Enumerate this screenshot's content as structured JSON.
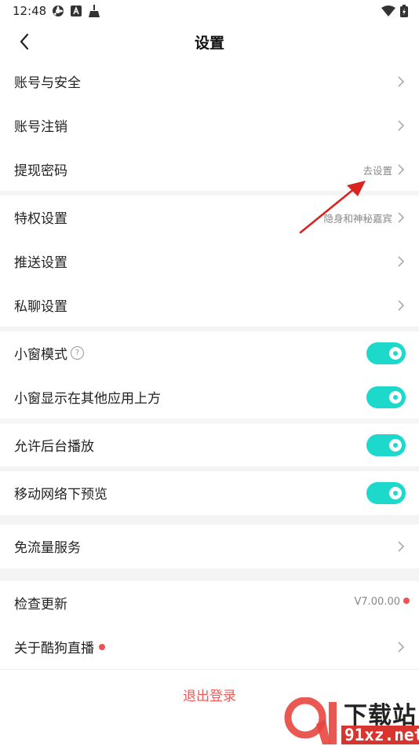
{
  "status_bar": {
    "time": "12:48"
  },
  "header": {
    "title": "设置"
  },
  "sections": {
    "account": [
      {
        "label": "账号与安全",
        "value": ""
      },
      {
        "label": "账号注销",
        "value": ""
      },
      {
        "label": "提现密码",
        "value": "去设置"
      }
    ],
    "privacy": [
      {
        "label": "特权设置",
        "value": "隐身和神秘嘉宾"
      },
      {
        "label": "推送设置",
        "value": ""
      },
      {
        "label": "私聊设置",
        "value": ""
      }
    ],
    "window": [
      {
        "label": "小窗模式",
        "toggle": true,
        "help_icon": "question-circle-icon"
      },
      {
        "label": "小窗显示在其他应用上方",
        "toggle": true
      }
    ],
    "background_play": {
      "label": "允许后台播放",
      "toggle": true
    },
    "mobile_preview": {
      "label": "移动网络下预览",
      "toggle": true
    },
    "data_service": {
      "label": "免流量服务"
    },
    "about": [
      {
        "label": "检查更新",
        "value": "V7.00.00",
        "badge": true
      },
      {
        "label": "关于酷狗直播",
        "badge": true
      }
    ]
  },
  "logout": {
    "label": "退出登录"
  },
  "watermark": {
    "top": "下载站",
    "bottom": "91xz.net"
  },
  "colors": {
    "toggle_on": "#1dd9cc",
    "badge": "#f0524f",
    "logout": "#ef5a5a",
    "annotation_arrow": "#d9231f"
  }
}
